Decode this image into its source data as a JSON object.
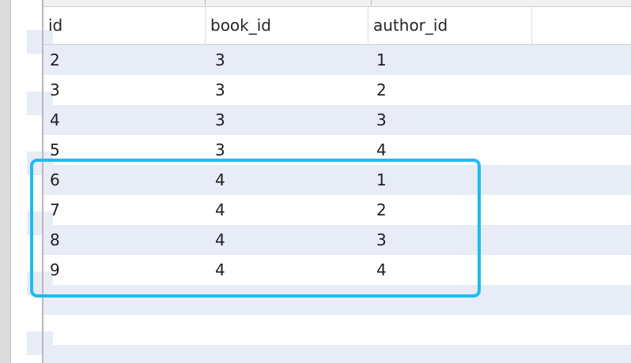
{
  "table": {
    "columns": [
      "id",
      "book_id",
      "author_id"
    ],
    "rows": [
      {
        "id": "2",
        "book_id": "3",
        "author_id": "1"
      },
      {
        "id": "3",
        "book_id": "3",
        "author_id": "2"
      },
      {
        "id": "4",
        "book_id": "3",
        "author_id": "3"
      },
      {
        "id": "5",
        "book_id": "3",
        "author_id": "4"
      },
      {
        "id": "6",
        "book_id": "4",
        "author_id": "1"
      },
      {
        "id": "7",
        "book_id": "4",
        "author_id": "2"
      },
      {
        "id": "8",
        "book_id": "4",
        "author_id": "3"
      },
      {
        "id": "9",
        "book_id": "4",
        "author_id": "4"
      }
    ]
  },
  "colors": {
    "row_alt": "#e7ecf7",
    "highlight": "#1cbcf2"
  }
}
